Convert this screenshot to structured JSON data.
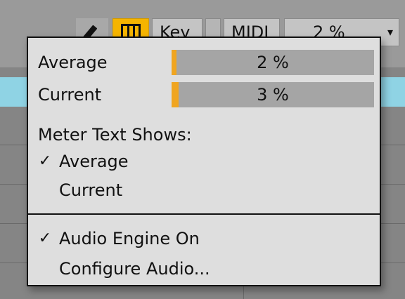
{
  "toolbar": {
    "key_label": "Key",
    "midi_label": "MIDI",
    "cpu_value": "2 %",
    "caret": "▾"
  },
  "menu": {
    "meters": [
      {
        "label": "Average",
        "value_text": "2 %",
        "level": 0.02
      },
      {
        "label": "Current",
        "value_text": "3 %",
        "level": 0.03
      }
    ],
    "meter_text_title": "Meter Text Shows:",
    "meter_text_options": [
      {
        "label": "Average",
        "checked": true
      },
      {
        "label": "Current",
        "checked": false
      }
    ],
    "engine_items": [
      {
        "label": "Audio Engine On",
        "checked": true
      },
      {
        "label": "Configure Audio...",
        "checked": false
      }
    ],
    "check_glyph": "✓",
    "accent_color": "#f0a520"
  }
}
